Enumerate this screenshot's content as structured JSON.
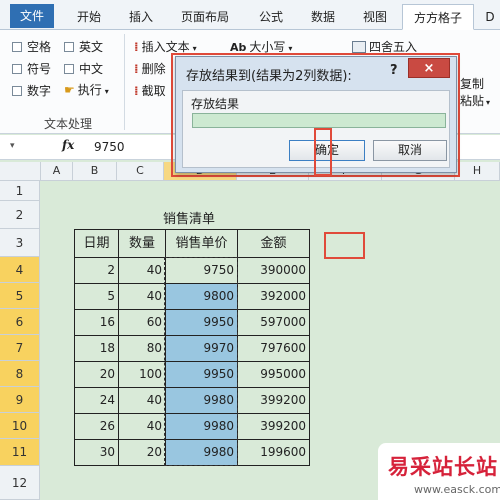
{
  "ribbon_tabs": [
    "文件",
    "开始",
    "插入",
    "页面布局",
    "公式",
    "数据",
    "视图",
    "方方格子",
    "D"
  ],
  "ribbon": {
    "checkboxes": [
      "空格",
      "英文",
      "符号",
      "中文",
      "数字"
    ],
    "exec_label": "执行",
    "group_label": "文本处理",
    "insert_text": "插入文本",
    "case_label": "大小写",
    "delete_label": "删除",
    "intercept_label": "截取",
    "round_label": "四舍五入",
    "copy_label": "复制",
    "paste_label": "粘贴"
  },
  "formula_bar": {
    "fx": "fx",
    "value": "9750"
  },
  "columns": [
    "A",
    "B",
    "C",
    "D",
    "E",
    "F",
    "G",
    "H"
  ],
  "rows": [
    "1",
    "2",
    "3",
    "4",
    "5",
    "6",
    "7",
    "8",
    "9",
    "10",
    "11",
    "12"
  ],
  "sheet": {
    "title": "销售清单",
    "headers": [
      "日期",
      "数量",
      "销售单价",
      "金额"
    ],
    "data": [
      [
        "2",
        "40",
        "9750",
        "390000"
      ],
      [
        "5",
        "40",
        "9800",
        "392000"
      ],
      [
        "16",
        "60",
        "9950",
        "597000"
      ],
      [
        "18",
        "80",
        "9970",
        "797600"
      ],
      [
        "20",
        "100",
        "9950",
        "995000"
      ],
      [
        "24",
        "40",
        "9980",
        "399200"
      ],
      [
        "26",
        "40",
        "9980",
        "399200"
      ],
      [
        "30",
        "20",
        "9980",
        "199600"
      ]
    ]
  },
  "dialog": {
    "title": "存放结果到(结果为2列数据):",
    "help": "?",
    "close": "×",
    "label": "存放结果",
    "ok": "确定",
    "cancel": "取消"
  },
  "watermark": {
    "brand": "易采站长站",
    "url": "www.easck.com"
  },
  "colors": {
    "accent": "#2f6fb3",
    "highlight": "#e04a3a",
    "selection_fill": "#99c6e0"
  }
}
